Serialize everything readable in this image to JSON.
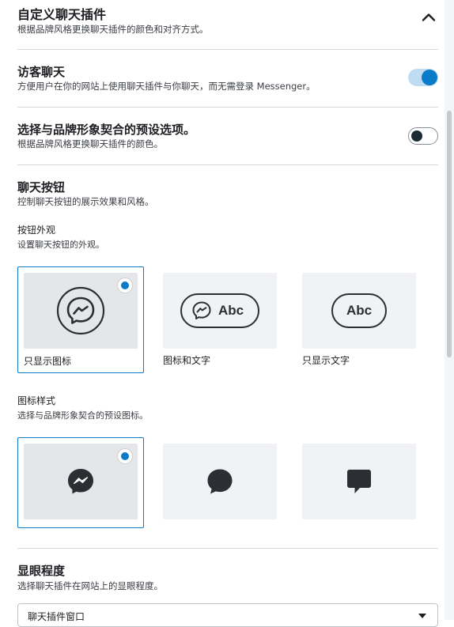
{
  "header": {
    "title": "自定义聊天插件",
    "subtitle": "根据品牌风格更换聊天插件的颜色和对齐方式。",
    "collapse_icon": "chevron-up-icon"
  },
  "guest_chat": {
    "title": "访客聊天",
    "description": "方便用户在你的网站上使用聊天插件与你聊天，而无需登录 Messenger。",
    "enabled": true
  },
  "preset": {
    "title": "选择与品牌形象契合的预设选项。",
    "description": "根据品牌风格更换聊天插件的颜色。",
    "enabled": false
  },
  "chat_button": {
    "title": "聊天按钮",
    "description": "控制聊天按钮的展示效果和风格。",
    "appearance": {
      "title": "按钮外观",
      "description": "设置聊天按钮的外观。",
      "options": [
        {
          "label": "只显示图标",
          "selected": true,
          "icon": "messenger-icon"
        },
        {
          "label": "图标和文字",
          "selected": false,
          "icon": "messenger-icon",
          "text": "Abc"
        },
        {
          "label": "只显示文字",
          "selected": false,
          "text": "Abc"
        }
      ]
    },
    "icon_style": {
      "title": "图标样式",
      "description": "选择与品牌形象契合的预设图标。",
      "options": [
        {
          "icon": "messenger-icon",
          "selected": true
        },
        {
          "icon": "chat-bubble-round-icon",
          "selected": false
        },
        {
          "icon": "chat-bubble-square-icon",
          "selected": false
        }
      ]
    }
  },
  "prominence": {
    "title": "显眼程度",
    "description": "选择聊天插件在网站上的显眼程度。",
    "selected": "聊天插件窗口"
  },
  "colors": {
    "accent": "#0a7bc8",
    "toggle_on_track": "#c0dcf3",
    "selected_thumb": "#e4e6e9",
    "plain_thumb": "#f0f2f5"
  }
}
